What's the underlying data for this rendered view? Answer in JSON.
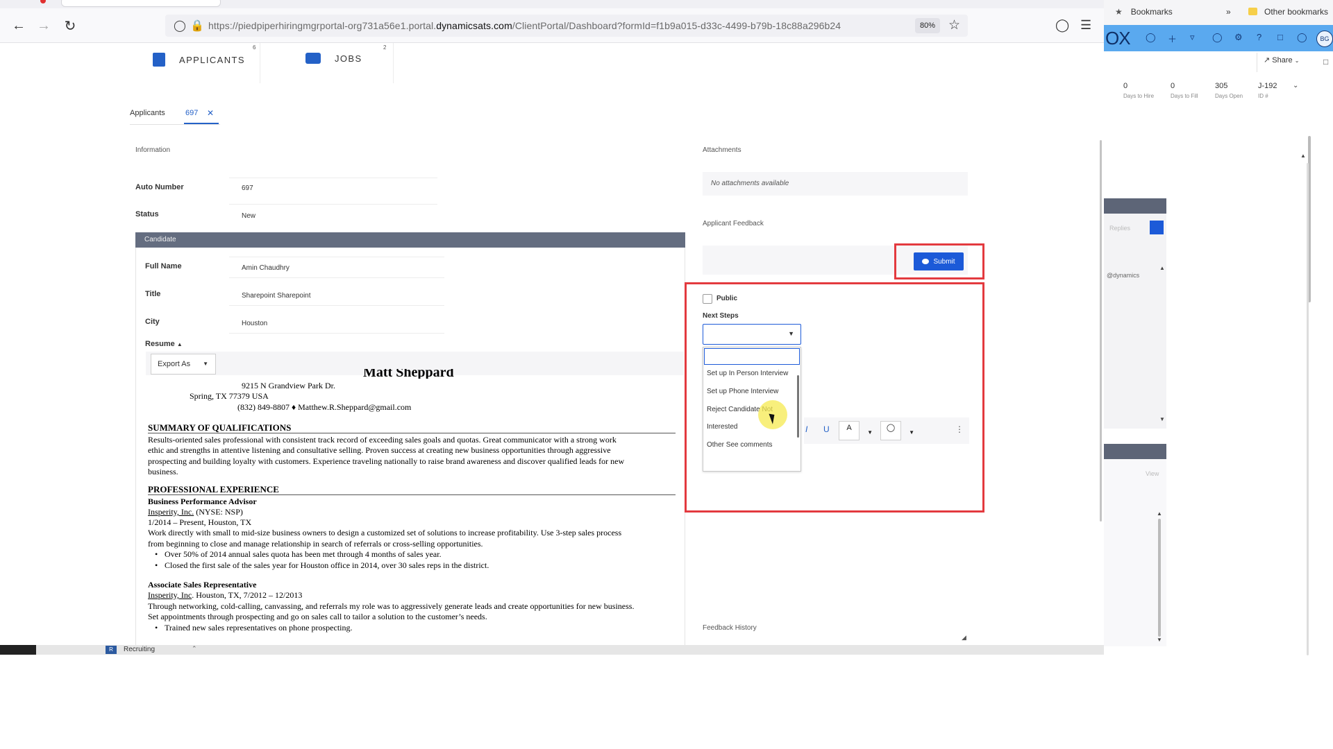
{
  "browser": {
    "url_prefix": "https://piedpiperhiringmgrportal-org731a56e1.portal.",
    "url_domain": "dynamicsats.com",
    "url_suffix": "/ClientPortal/Dashboard?formId=f1b9a015-d33c-4499-b79b-18c88a296b24",
    "zoom": "80%",
    "icons": [
      "back-arrow-icon",
      "forward-arrow-icon",
      "reload-icon",
      "shield-icon",
      "lock-icon",
      "star-icon",
      "pocket-icon",
      "menu-icon"
    ]
  },
  "top_nav": {
    "items": [
      {
        "label": "APPLICANTS",
        "count": "6",
        "icon": "document-icon"
      },
      {
        "label": "JOBS",
        "count": "2",
        "icon": "briefcase-icon"
      }
    ]
  },
  "breadcrumb": {
    "root": "Applicants",
    "current": "697",
    "close": "✕"
  },
  "information": {
    "section": "Information",
    "fields": [
      {
        "label": "Auto Number",
        "value": "697"
      },
      {
        "label": "Status",
        "value": "New"
      }
    ]
  },
  "candidate": {
    "section": "Candidate",
    "fields": [
      {
        "label": "Full Name",
        "value": "Amin Chaudhry"
      },
      {
        "label": "Title",
        "value": "Sharepoint Sharepoint"
      },
      {
        "label": "City",
        "value": "Houston"
      }
    ],
    "resume_label": "Resume",
    "export_label": "Export As"
  },
  "resume": {
    "name": "Matt Sheppard",
    "address1": "9215 N Grandview Park Dr.",
    "address2": "Spring, TX 77379 USA",
    "contact": "(832) 849-8807 ♦ Matthew.R.Sheppard@gmail.com",
    "summary_head": "SUMMARY OF QUALIFICATIONS",
    "summary_1": "Results-oriented sales professional with consistent track record of exceeding sales goals and quotas. Great communicator with a strong work",
    "summary_2": "ethic and strengths in attentive listening and consultative selling. Proven success at creating new business opportunities through aggressive",
    "summary_3": "prospecting and building loyalty with customers. Experience traveling nationally to raise brand awareness and discover qualified leads for new",
    "summary_4": "business.",
    "exp_head": "PROFESSIONAL EXPERIENCE",
    "job1_title": "Business Performance Advisor",
    "job1_company": "Insperity, Inc.",
    "job1_company_rest": " (NYSE: NSP)",
    "job1_dates": "1/2014 – Present, Houston, TX",
    "job1_desc_1": "Work directly with small to mid-size business owners to design a customized set of solutions to increase profitability. Use 3-step sales process",
    "job1_desc_2": "from beginning to close and manage relationship in search of referrals or cross-selling opportunities.",
    "job1_b1": "Over 50% of 2014 annual sales quota has been met through 4 months of sales year.",
    "job1_b2": "Closed the first sale of the sales year for Houston office in 2014, over 30 sales reps in the district.",
    "job2_title": "Associate Sales Representative",
    "job2_company": "Insperity, Inc",
    "job2_rest": ". Houston, TX, 7/2012 – 12/2013",
    "job2_desc_1": "Through networking, cold-calling, canvassing, and referrals my role was to aggressively generate leads and create opportunities for new business.",
    "job2_desc_2": "Set appointments through prospecting and go on sales call to tailor a solution to the customer’s needs.",
    "job2_b1": "Trained new sales representatives on phone prospecting."
  },
  "attachments": {
    "section": "Attachments",
    "empty": "No attachments available"
  },
  "feedback": {
    "section": "Applicant Feedback",
    "submit": "Submit",
    "public_label": "Public",
    "next_steps_label": "Next Steps",
    "options": [
      "Set up In Person Interview",
      "Set up Phone Interview",
      "Reject Candidate Not",
      "Interested",
      "Other See comments"
    ],
    "rte_italic": "I",
    "rte_underline": "U",
    "rte_font_color": "A",
    "rte_more": "⋮",
    "history": "Feedback History"
  },
  "taskbar": {
    "badge": "R",
    "label": "Recruiting"
  },
  "right_window": {
    "bookmarks": "Bookmarks",
    "more": "»",
    "other_bookmarks": "Other bookmarks",
    "logo": "OX",
    "avatar": "BG",
    "share": "Share",
    "stats": [
      {
        "value": "0",
        "label": "Days to Hire"
      },
      {
        "value": "0",
        "label": "Days to Fill"
      },
      {
        "value": "305",
        "label": "Days Open"
      },
      {
        "value": "J-192",
        "label": "ID #"
      }
    ],
    "label_a": "Replies",
    "handle": "@dynamics",
    "label_b": "View"
  },
  "colors": {
    "accent": "#1c5ad8",
    "highlight_box": "#e33a3f",
    "candidate_bar": "#646d80",
    "appbar": "#5aa9ef"
  }
}
